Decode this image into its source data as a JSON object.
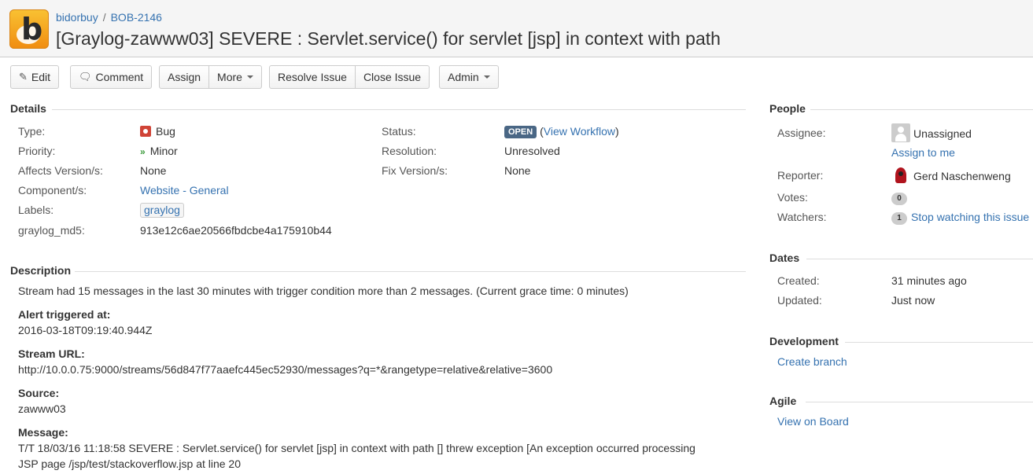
{
  "header": {
    "project": "bidorbuy",
    "separator": "/",
    "issue_key": "BOB-2146",
    "summary": "[Graylog-zawww03] SEVERE : Servlet.service() for servlet [jsp] in context with path"
  },
  "toolbar": {
    "edit": "Edit",
    "comment": "Comment",
    "assign": "Assign",
    "more": "More",
    "resolve": "Resolve Issue",
    "close": "Close Issue",
    "admin": "Admin"
  },
  "details": {
    "heading": "Details",
    "type_label": "Type:",
    "type_value": "Bug",
    "priority_label": "Priority:",
    "priority_value": "Minor",
    "affects_label": "Affects Version/s:",
    "affects_value": "None",
    "component_label": "Component/s:",
    "component_value": "Website - General",
    "labels_label": "Labels:",
    "labels_value": "graylog",
    "md5_label": "graylog_md5:",
    "md5_value": "913e12c6ae20566fbdcbe4a175910b44",
    "status_label": "Status:",
    "status_value": "OPEN",
    "workflow_open": "(",
    "workflow_link": "View Workflow",
    "workflow_close": ")",
    "resolution_label": "Resolution:",
    "resolution_value": "Unresolved",
    "fix_label": "Fix Version/s:",
    "fix_value": "None"
  },
  "description": {
    "heading": "Description",
    "intro": "Stream had 15 messages in the last 30 minutes with trigger condition more than 2 messages. (Current grace time: 0 minutes)",
    "alert_label": "Alert triggered at:",
    "alert_value": "2016-03-18T09:19:40.944Z",
    "stream_label": "Stream URL:",
    "stream_value": "http://10.0.0.75:9000/streams/56d847f77aaefc445ec52930/messages?q=*&rangetype=relative&relative=3600",
    "source_label": "Source:",
    "source_value": "zawww03",
    "message_label": "Message:",
    "message_line1": "T/T 18/03/16 11:18:58 SEVERE : Servlet.service() for servlet [jsp] in context with path [] threw exception [An exception occurred processing",
    "message_line2": "JSP page /jsp/test/stackoverflow.jsp at line 20"
  },
  "people": {
    "heading": "People",
    "assignee_label": "Assignee:",
    "assignee_value": "Unassigned",
    "assign_to_me": "Assign to me",
    "reporter_label": "Reporter:",
    "reporter_value": "Gerd Naschenweng",
    "votes_label": "Votes:",
    "votes_count": "0",
    "watchers_label": "Watchers:",
    "watchers_count": "1",
    "stop_watching": "Stop watching this issue"
  },
  "dates": {
    "heading": "Dates",
    "created_label": "Created:",
    "created_value": "31 minutes ago",
    "updated_label": "Updated:",
    "updated_value": "Just now"
  },
  "development": {
    "heading": "Development",
    "create_branch": "Create branch"
  },
  "agile": {
    "heading": "Agile",
    "view_on_board": "View on Board"
  }
}
